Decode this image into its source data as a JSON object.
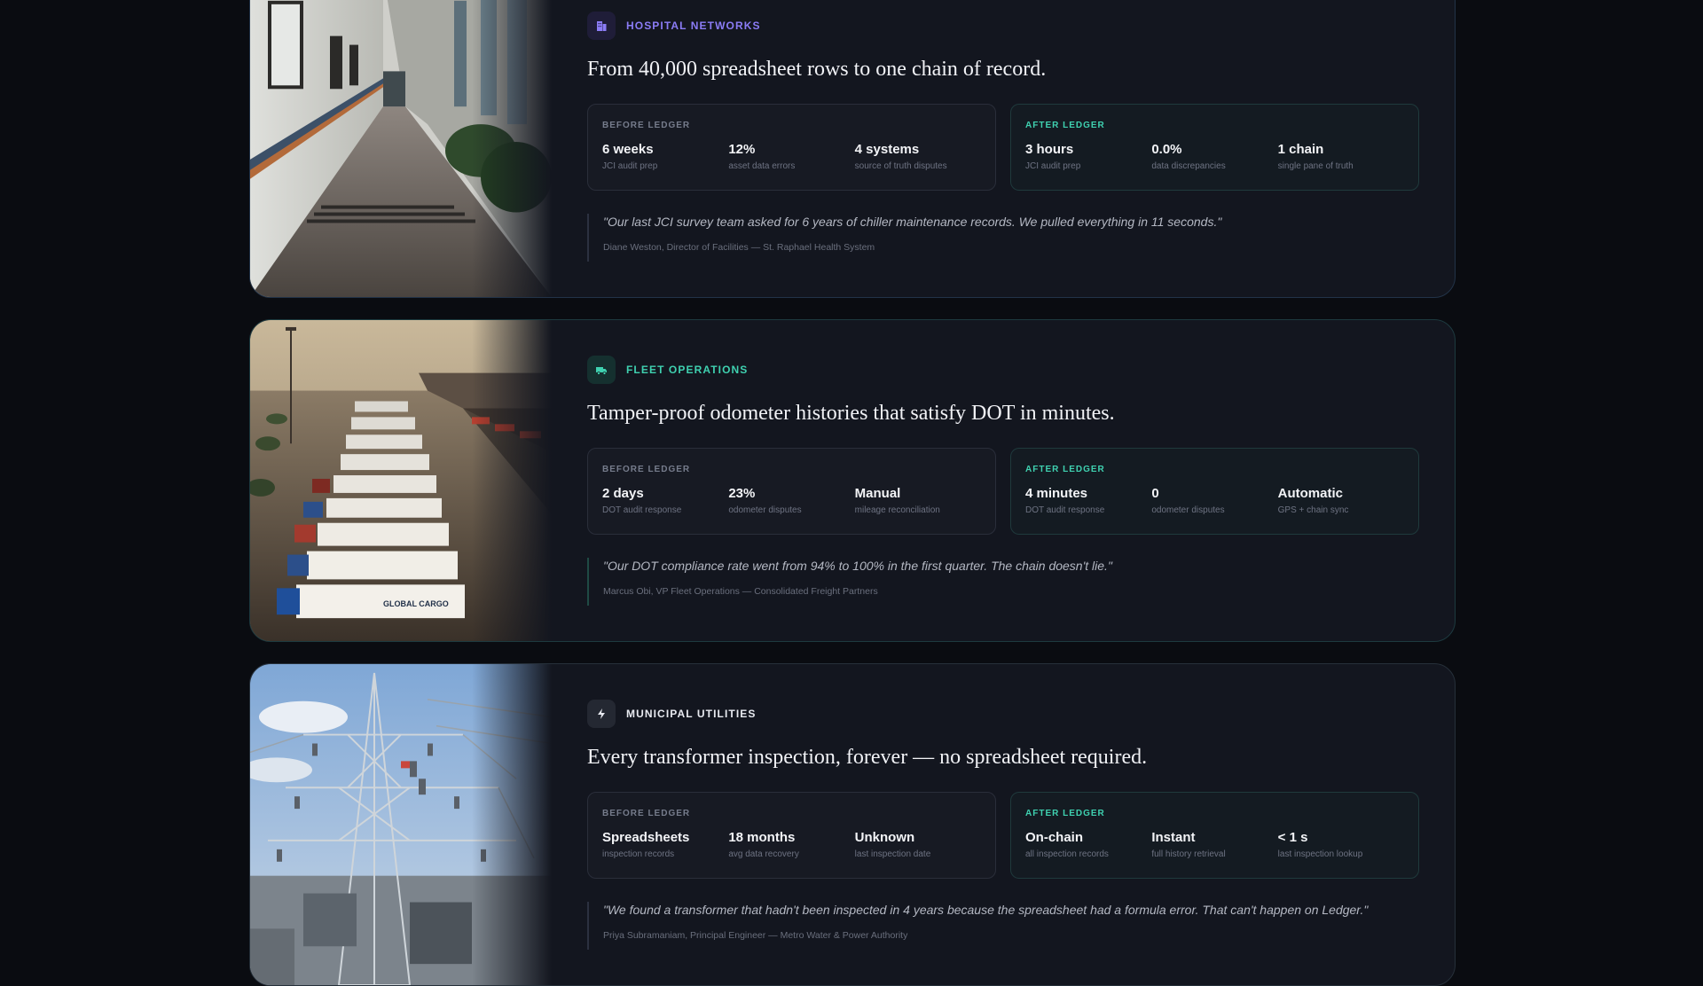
{
  "cards": [
    {
      "tag": "HOSPITAL NETWORKS",
      "tag_icon": "hospital-building-icon",
      "headline": "From 40,000 spreadsheet rows to one chain of record.",
      "before": {
        "title": "BEFORE LEDGER",
        "stats": [
          {
            "value": "6 weeks",
            "label": "JCI audit prep"
          },
          {
            "value": "12%",
            "label": "asset data errors"
          },
          {
            "value": "4 systems",
            "label": "source of truth disputes"
          }
        ]
      },
      "after": {
        "title": "AFTER LEDGER",
        "stats": [
          {
            "value": "3 hours",
            "label": "JCI audit prep"
          },
          {
            "value": "0.0%",
            "label": "data discrepancies"
          },
          {
            "value": "1 chain",
            "label": "single pane of truth"
          }
        ]
      },
      "quote": "\"Our last JCI survey team asked for 6 years of chiller maintenance records. We pulled everything in 11 seconds.\"",
      "attribution": "Diane Weston, Director of Facilities — St. Raphael Health System"
    },
    {
      "tag": "FLEET OPERATIONS",
      "tag_icon": "truck-icon",
      "headline": "Tamper-proof odometer histories that satisfy DOT in minutes.",
      "before": {
        "title": "BEFORE LEDGER",
        "stats": [
          {
            "value": "2 days",
            "label": "DOT audit response"
          },
          {
            "value": "23%",
            "label": "odometer disputes"
          },
          {
            "value": "Manual",
            "label": "mileage reconciliation"
          }
        ]
      },
      "after": {
        "title": "AFTER LEDGER",
        "stats": [
          {
            "value": "4 minutes",
            "label": "DOT audit response"
          },
          {
            "value": "0",
            "label": "odometer disputes"
          },
          {
            "value": "Automatic",
            "label": "GPS + chain sync"
          }
        ]
      },
      "quote": "\"Our DOT compliance rate went from 94% to 100% in the first quarter. The chain doesn't lie.\"",
      "attribution": "Marcus Obi, VP Fleet Operations — Consolidated Freight Partners"
    },
    {
      "tag": "MUNICIPAL UTILITIES",
      "tag_icon": "lightning-bolt-icon",
      "headline": "Every transformer inspection, forever — no spreadsheet required.",
      "before": {
        "title": "BEFORE LEDGER",
        "stats": [
          {
            "value": "Spreadsheets",
            "label": "inspection records"
          },
          {
            "value": "18 months",
            "label": "avg data recovery"
          },
          {
            "value": "Unknown",
            "label": "last inspection date"
          }
        ]
      },
      "after": {
        "title": "AFTER LEDGER",
        "stats": [
          {
            "value": "On-chain",
            "label": "all inspection records"
          },
          {
            "value": "Instant",
            "label": "full history retrieval"
          },
          {
            "value": "< 1 s",
            "label": "last inspection lookup"
          }
        ]
      },
      "quote": "\"We found a transformer that hadn't been inspected in 4 years because the spreadsheet had a formula error. That can't happen on Ledger.\"",
      "attribution": "Priya Subramaniam, Principal Engineer — Metro Water & Power Authority"
    }
  ],
  "truck_trailer_text": "GLOBAL CARGO",
  "colors": {
    "background": "#0a0c11",
    "card": "#13161f",
    "hospital_accent": "#8b7cf6",
    "fleet_accent": "#3fd1b0",
    "utility_accent": "#e8eaf0"
  }
}
